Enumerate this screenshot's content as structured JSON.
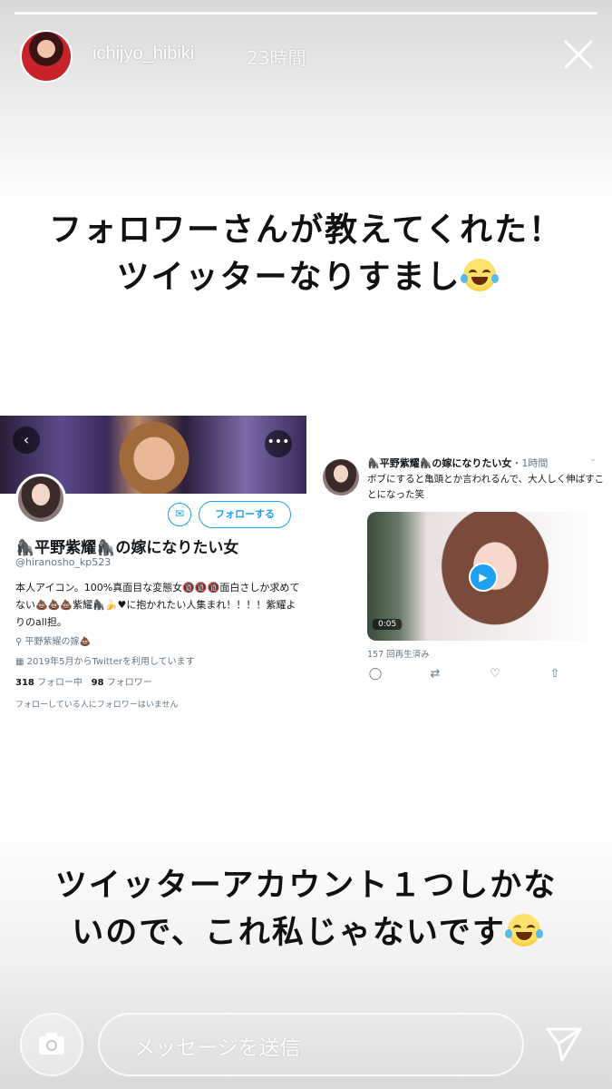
{
  "header": {
    "username": "ichijyo_hibiki",
    "timestamp": "23時間",
    "progress_fraction": 1.0
  },
  "captions": {
    "top_line1": "フォロワーさんが教えてくれた！",
    "top_line2": "ツイッターなりすまし",
    "bottom_line1": "ツイッターアカウント１つしかな",
    "bottom_line2": "いので、これ私じゃないです"
  },
  "profile": {
    "follow_label": "フォローする",
    "name": "🦍平野紫耀🦍の嫁になりたい女",
    "handle": "@hiranosho_kp523",
    "bio": "本人アイコン。100%真面目な変態女🔞🔞🔞面白さしか求めてない💩💩💩紫耀🦍🍌♥に抱かれたい人集まれ！！！！紫耀よりのall担。",
    "location": "平野紫耀の嫁💩",
    "joined": "2019年5月からTwitterを利用しています",
    "following_count": "318",
    "following_label": "フォロー中",
    "followers_count": "98",
    "followers_label": "フォロワー",
    "mutual_note": "フォローしている人にフォロワーはいません"
  },
  "tweet": {
    "name": "🦍平野紫耀🦍の嫁になりたい女",
    "time": "・1時間",
    "text": "ボブにすると亀頭とか言われるんで、大人しく伸ばすことになった笑",
    "duration": "0:05",
    "views": "157 回再生済み"
  },
  "footer": {
    "message_placeholder": "メッセージを送信"
  },
  "colors": {
    "twitter_blue": "#1da1f2",
    "caption_text": "#111111"
  },
  "icons": [
    "close-icon",
    "camera-icon",
    "send-icon",
    "mail-icon",
    "location-icon",
    "calendar-icon",
    "reply-icon",
    "retweet-icon",
    "like-icon",
    "share-icon",
    "play-icon",
    "back-icon",
    "more-icon",
    "laughing-emoji"
  ]
}
